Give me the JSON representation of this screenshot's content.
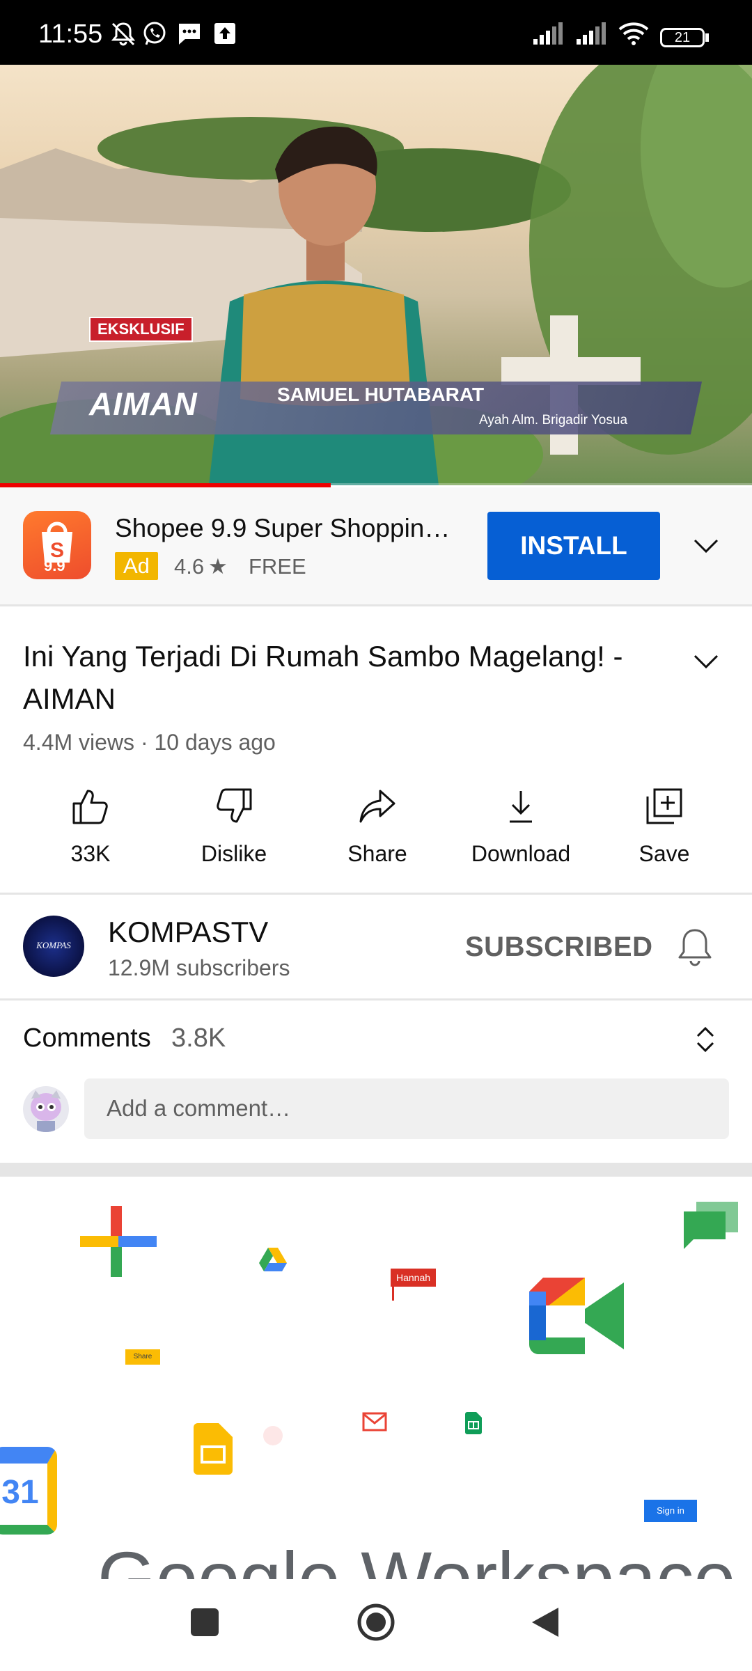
{
  "status_bar": {
    "time": "11:55",
    "battery": "21"
  },
  "video": {
    "tag": "EKSKLUSIF",
    "show_logo": "AIMAN",
    "lower_third_name": "SAMUEL HUTABARAT",
    "lower_third_caption": "Ayah  Alm. Brigadir Yosua",
    "progress": 0.44
  },
  "ad": {
    "app_icon_text": "9.9",
    "title": "Shopee 9.9 Super Shoppin…",
    "badge": "Ad",
    "rating": "4.6",
    "price": "FREE",
    "install_label": "INSTALL"
  },
  "video_info": {
    "title": "Ini Yang Terjadi Di Rumah Sambo Magelang! - AIMAN",
    "views": "4.4M views",
    "age": "10 days ago",
    "meta_sep": " · "
  },
  "actions": {
    "like": "33K",
    "dislike": "Dislike",
    "share": "Share",
    "download": "Download",
    "save": "Save"
  },
  "channel": {
    "avatar_text": "KOMPAS",
    "name": "KOMPASTV",
    "subscribers": "12.9M subscribers",
    "subscribe_label": "SUBSCRIBED"
  },
  "comments": {
    "label": "Comments",
    "count": "3.8K",
    "placeholder": "Add a comment…"
  },
  "banner": {
    "chat_name": "Hannah",
    "share_chip": "Share",
    "calendar_day": "31",
    "sign_in": "Sign in",
    "brand_text": "Google Workspace"
  },
  "colors": {
    "accent": "#065fd4",
    "progress": "#ee0000",
    "ad_badge": "#f2b600"
  }
}
